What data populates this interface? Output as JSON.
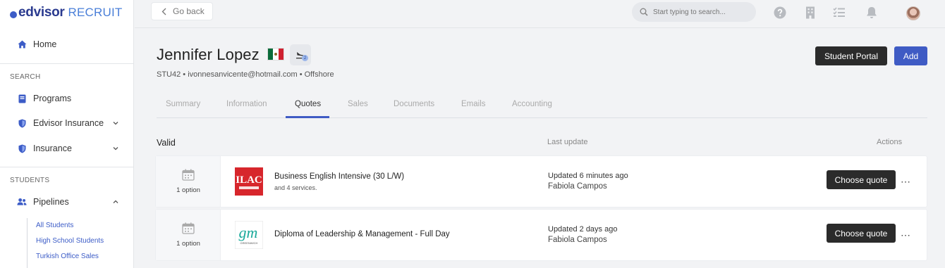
{
  "brand": {
    "name": "edvisor",
    "product": "RECRUIT"
  },
  "sidebar": {
    "home": "Home",
    "search_section": "SEARCH",
    "items": [
      {
        "label": "Programs"
      },
      {
        "label": "Edvisor Insurance"
      },
      {
        "label": "Insurance"
      }
    ],
    "students_section": "STUDENTS",
    "pipelines": "Pipelines",
    "subitems": [
      "All Students",
      "High School Students",
      "Turkish Office Sales"
    ]
  },
  "topbar": {
    "back_label": "Go back",
    "search_placeholder": "Start typing to search..."
  },
  "student": {
    "name": "Jennifer Lopez",
    "id": "STU42",
    "email": "ivonnesanvicente@hotmail.com",
    "location": "Offshore",
    "subline": "STU42 • ivonnesanvicente@hotmail.com • Offshore",
    "travel_count": "2"
  },
  "actions": {
    "student_portal": "Student Portal",
    "add": "Add"
  },
  "tabs": [
    {
      "label": "Summary"
    },
    {
      "label": "Information"
    },
    {
      "label": "Quotes"
    },
    {
      "label": "Sales"
    },
    {
      "label": "Documents"
    },
    {
      "label": "Emails"
    },
    {
      "label": "Accounting"
    }
  ],
  "quotes": {
    "section": "Valid",
    "col_last_update": "Last update",
    "col_actions": "Actions",
    "rows": [
      {
        "options": "1 option",
        "course": "Business English Intensive (30 L/W)",
        "services": "and 4 services.",
        "updated": "Updated 6 minutes ago",
        "agent": "Fabiola Campos",
        "action": "Choose quote",
        "more": "⋯",
        "logo_text": "ILAC"
      },
      {
        "options": "1 option",
        "course": "Diploma of Leadership & Management - Full Day",
        "services": "",
        "updated": "Updated 2 days ago",
        "agent": "Fabiola Campos",
        "action": "Choose quote",
        "more": "⋯",
        "logo_text": "GREENWICH"
      }
    ]
  },
  "colors": {
    "accent": "#3f5bc4",
    "dark_button": "#2b2b2b",
    "brand_dark": "#2a3a8f",
    "brand_light": "#4a7fd8"
  }
}
